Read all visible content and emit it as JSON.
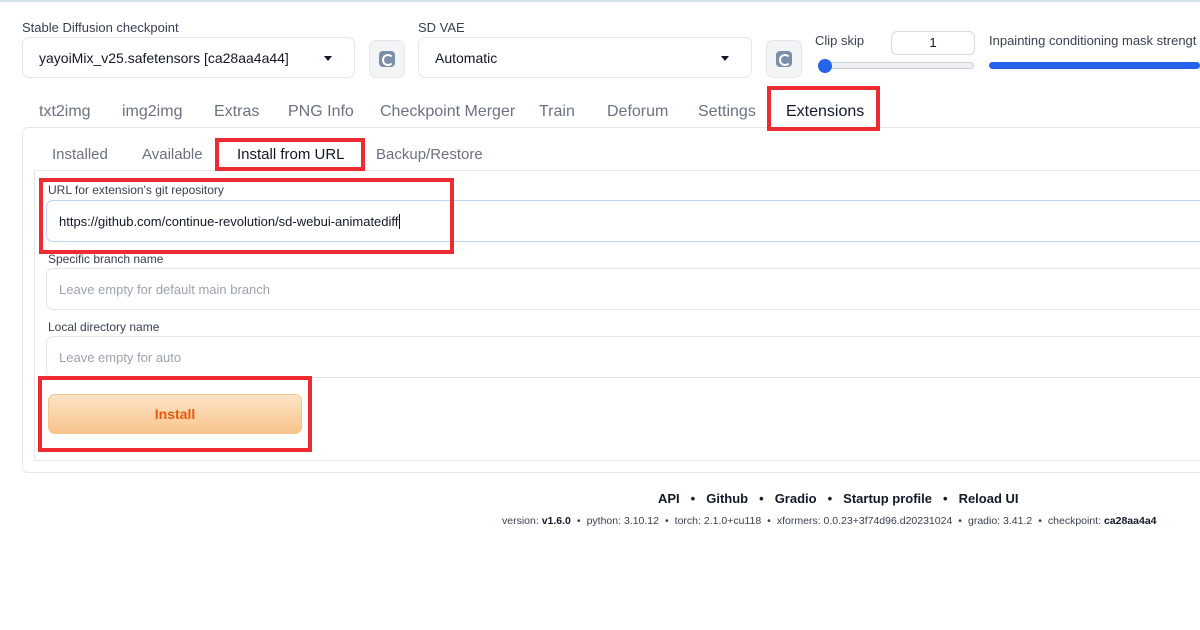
{
  "settings": {
    "checkpoint_label": "Stable Diffusion checkpoint",
    "checkpoint_value": "yayoiMix_v25.safetensors [ca28aa4a44]",
    "vae_label": "SD VAE",
    "vae_value": "Automatic",
    "clip_skip_label": "Clip skip",
    "clip_skip_value": "1",
    "inpaint_label": "Inpainting conditioning mask strengt",
    "clip_skip_slider_level": 0.0,
    "inpaint_slider_level": 1.0
  },
  "tabs": [
    "txt2img",
    "img2img",
    "Extras",
    "PNG Info",
    "Checkpoint Merger",
    "Train",
    "Deforum",
    "Settings",
    "Extensions"
  ],
  "active_tab": "Extensions",
  "subtabs": [
    "Installed",
    "Available",
    "Install from URL",
    "Backup/Restore"
  ],
  "active_subtab": "Install from URL",
  "form": {
    "url_label": "URL for extension's git repository",
    "url_value": "https://github.com/continue-revolution/sd-webui-animatediff",
    "branch_label": "Specific branch name",
    "branch_placeholder": "Leave empty for default main branch",
    "dir_label": "Local directory name",
    "dir_placeholder": "Leave empty for auto",
    "install_label": "Install"
  },
  "footer": {
    "links": [
      "API",
      "Github",
      "Gradio",
      "Startup profile",
      "Reload UI"
    ],
    "version_label": "version:",
    "version": "v1.6.0",
    "python": "python: 3.10.12",
    "torch": "torch: 2.1.0+cu118",
    "xformers": "xformers: 0.0.23+3f74d96.d20231024",
    "gradio": "gradio: 3.41.2",
    "checkpoint_label": "checkpoint:",
    "checkpoint": "ca28aa4a4"
  },
  "colors": {
    "highlight": "#ed2b33",
    "accent": "#2563eb",
    "install_text": "#e8590c"
  },
  "icons": [
    "refresh-icon",
    "chevron-down-icon"
  ]
}
